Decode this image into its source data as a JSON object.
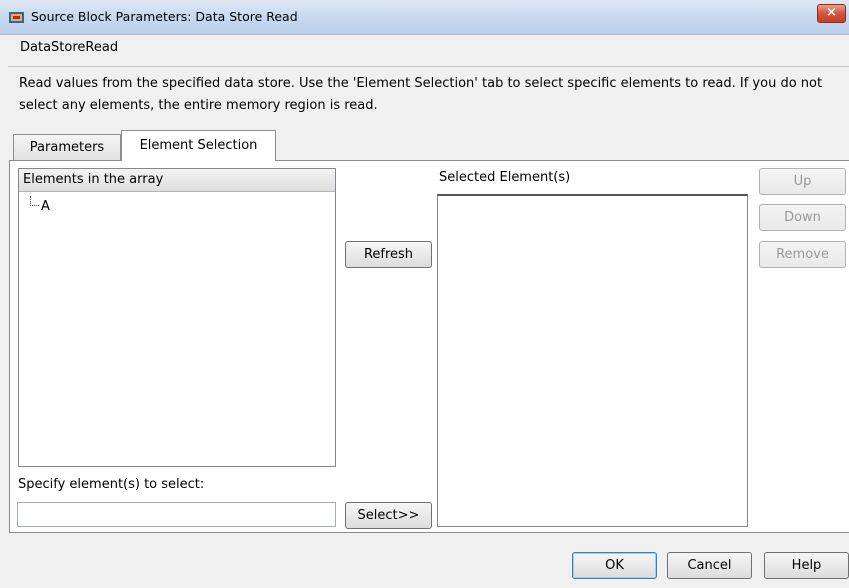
{
  "window": {
    "title": "Source Block Parameters: Data Store Read",
    "close_label": "×"
  },
  "block": {
    "name": "DataStoreRead",
    "description": "Read values from the specified data store. Use the 'Element Selection' tab to select specific elements to read. If you do not select any elements, the entire memory region is read."
  },
  "tabs": [
    {
      "label": "Parameters",
      "active": false
    },
    {
      "label": "Element Selection",
      "active": true
    }
  ],
  "elements_tree": {
    "header": "Elements in the array",
    "items": [
      "A"
    ]
  },
  "actions": {
    "refresh_label": "Refresh",
    "select_label": "Select>>"
  },
  "selected": {
    "label": "Selected Element(s)",
    "items": []
  },
  "side_buttons": {
    "up": "Up",
    "down": "Down",
    "remove": "Remove"
  },
  "specify": {
    "label": "Specify element(s) to select:",
    "value": ""
  },
  "dialog_buttons": {
    "ok": "OK",
    "cancel": "Cancel",
    "help": "Help"
  },
  "colors": {
    "close_button": "#c9432b",
    "disabled_text": "#999999",
    "default_button_border": "#3c7fb1"
  }
}
